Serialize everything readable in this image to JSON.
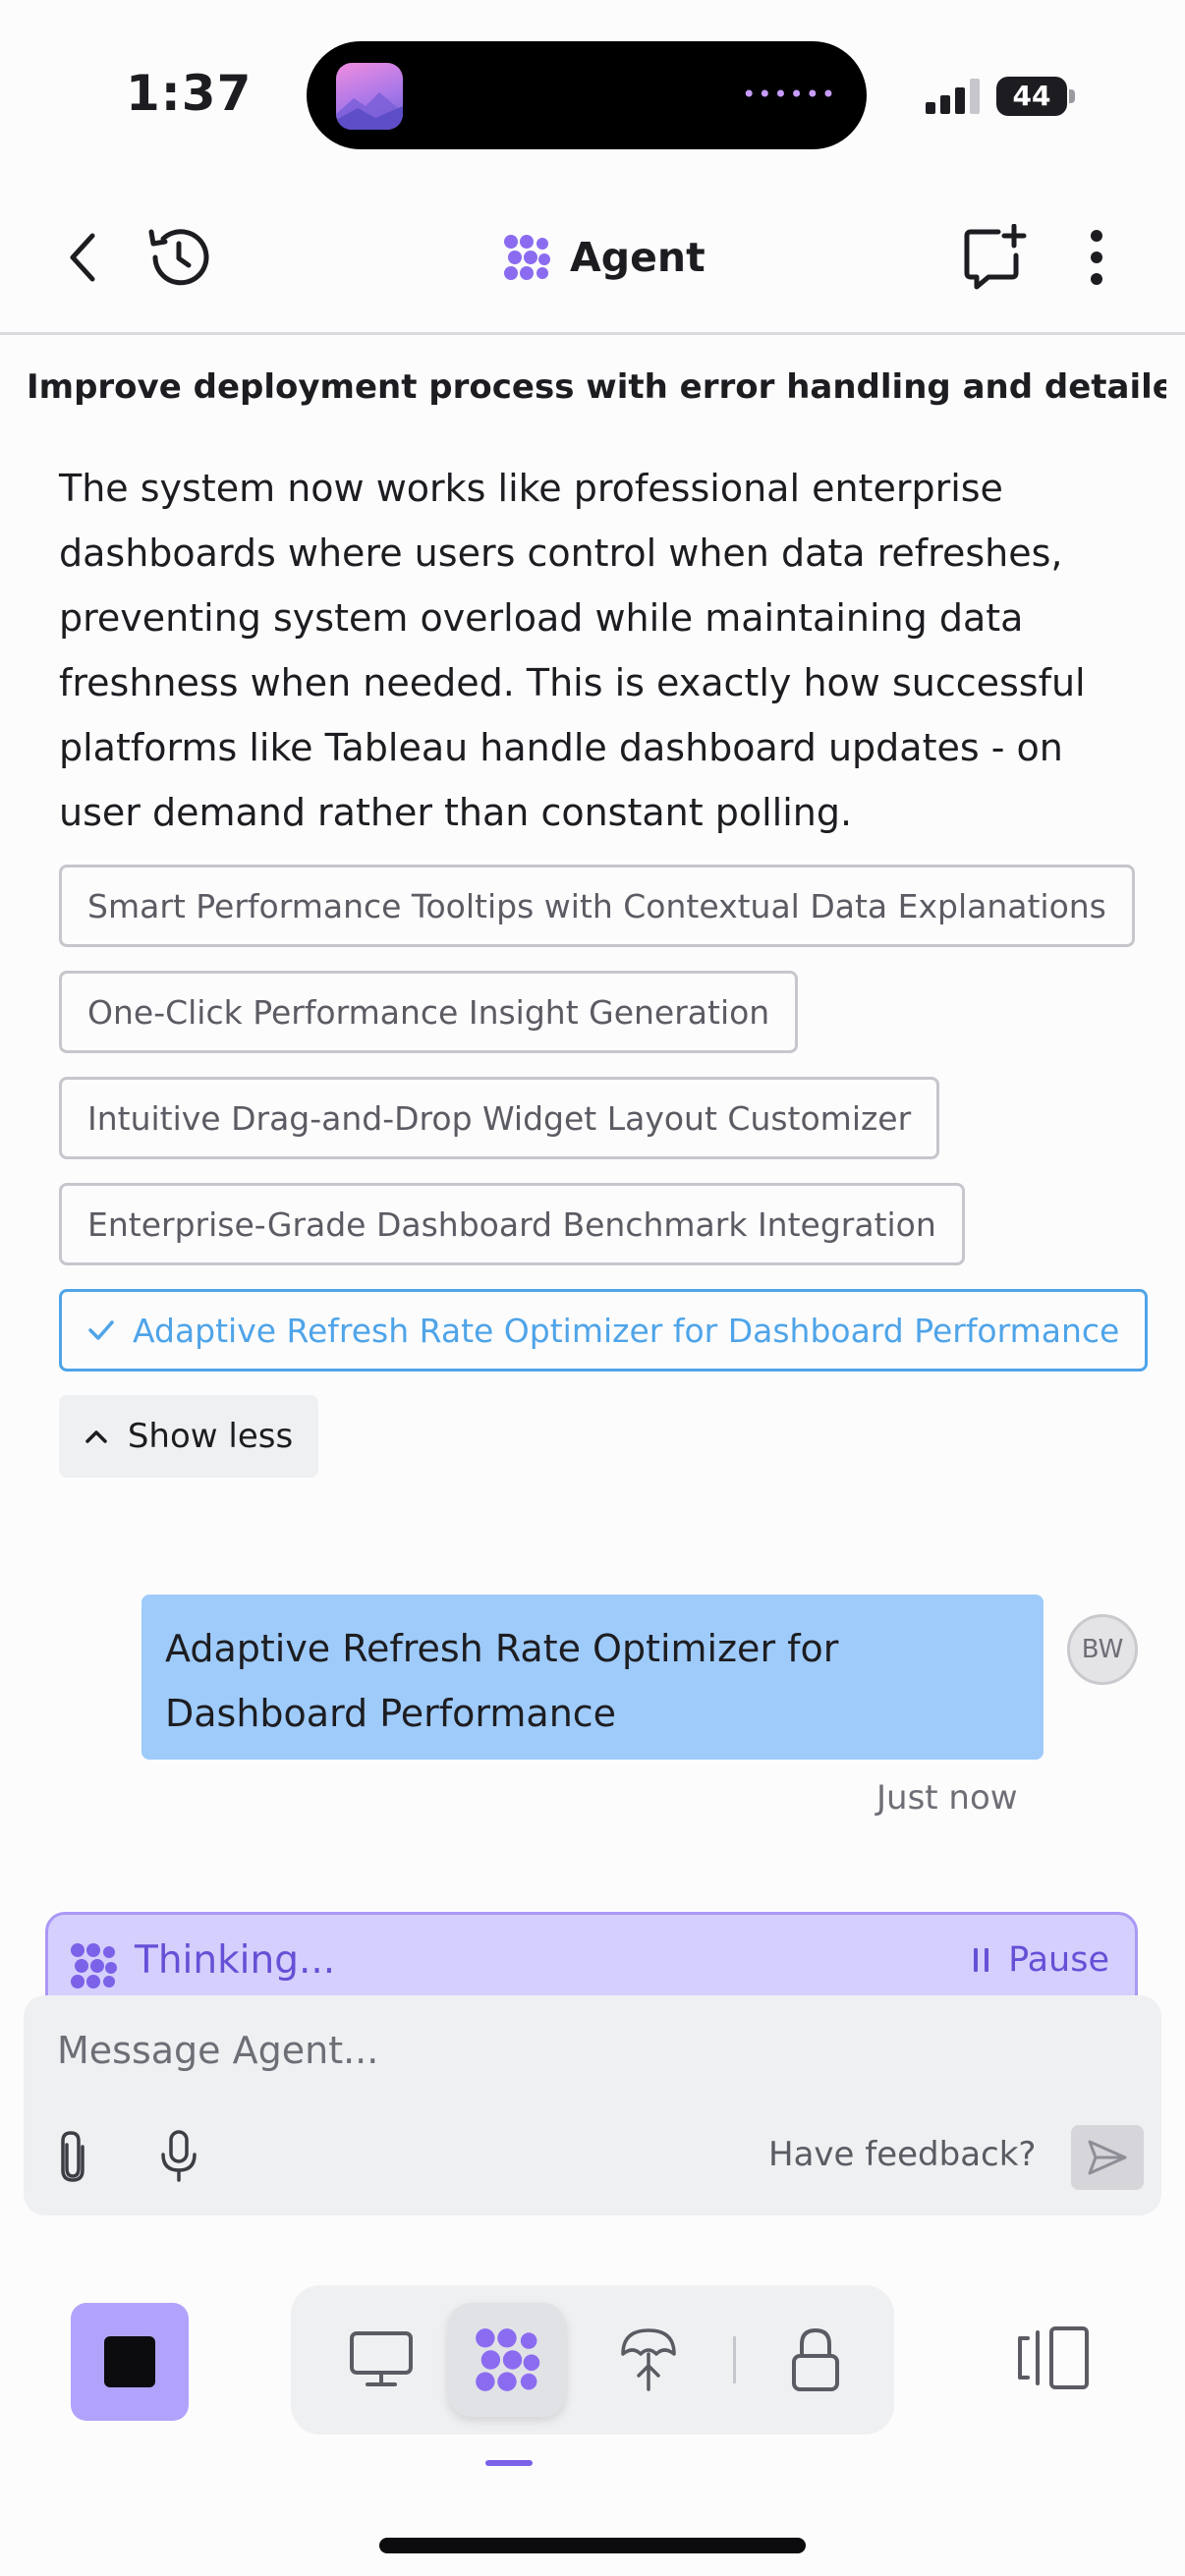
{
  "status_bar": {
    "time": "1:37",
    "battery": "44"
  },
  "header": {
    "title": "Agent",
    "back_icon": "chevron-left-icon",
    "history_icon": "history-icon",
    "new_chat_icon": "new-chat-icon",
    "more_icon": "more-vertical-icon"
  },
  "thread": {
    "title": "Improve deployment process with error handling and detailed valid..."
  },
  "message": {
    "text": "The system now works like professional enterprise dashboards where users control when data refreshes, preventing system overload while maintaining data freshness when needed. This is exactly how successful platforms like Tableau handle dashboard updates - on user demand rather than constant polling."
  },
  "suggestions": [
    {
      "label": "Smart Performance Tooltips with Contextual Data Explanations",
      "selected": false
    },
    {
      "label": "One-Click Performance Insight Generation",
      "selected": false
    },
    {
      "label": "Intuitive Drag-and-Drop Widget Layout Customizer",
      "selected": false
    },
    {
      "label": "Enterprise-Grade Dashboard Benchmark Integration",
      "selected": false
    },
    {
      "label": "Adaptive Refresh Rate Optimizer for Dashboard Performance",
      "selected": true
    }
  ],
  "show_less": {
    "label": "Show less"
  },
  "user_message": {
    "text": "Adaptive Refresh Rate Optimizer for Dashboard Performance",
    "avatar_initials": "BW",
    "timestamp": "Just now"
  },
  "thinking": {
    "label": "Thinking...",
    "pause_label": "Pause"
  },
  "composer": {
    "placeholder": "Message Agent...",
    "feedback_label": "Have feedback?"
  },
  "colors": {
    "accent": "#7b62e8",
    "selected_chip": "#4fa4e8",
    "user_bubble": "#9fcbfb",
    "thinking_bg": "#d5cffd",
    "stop_button": "#b1a3fb"
  }
}
